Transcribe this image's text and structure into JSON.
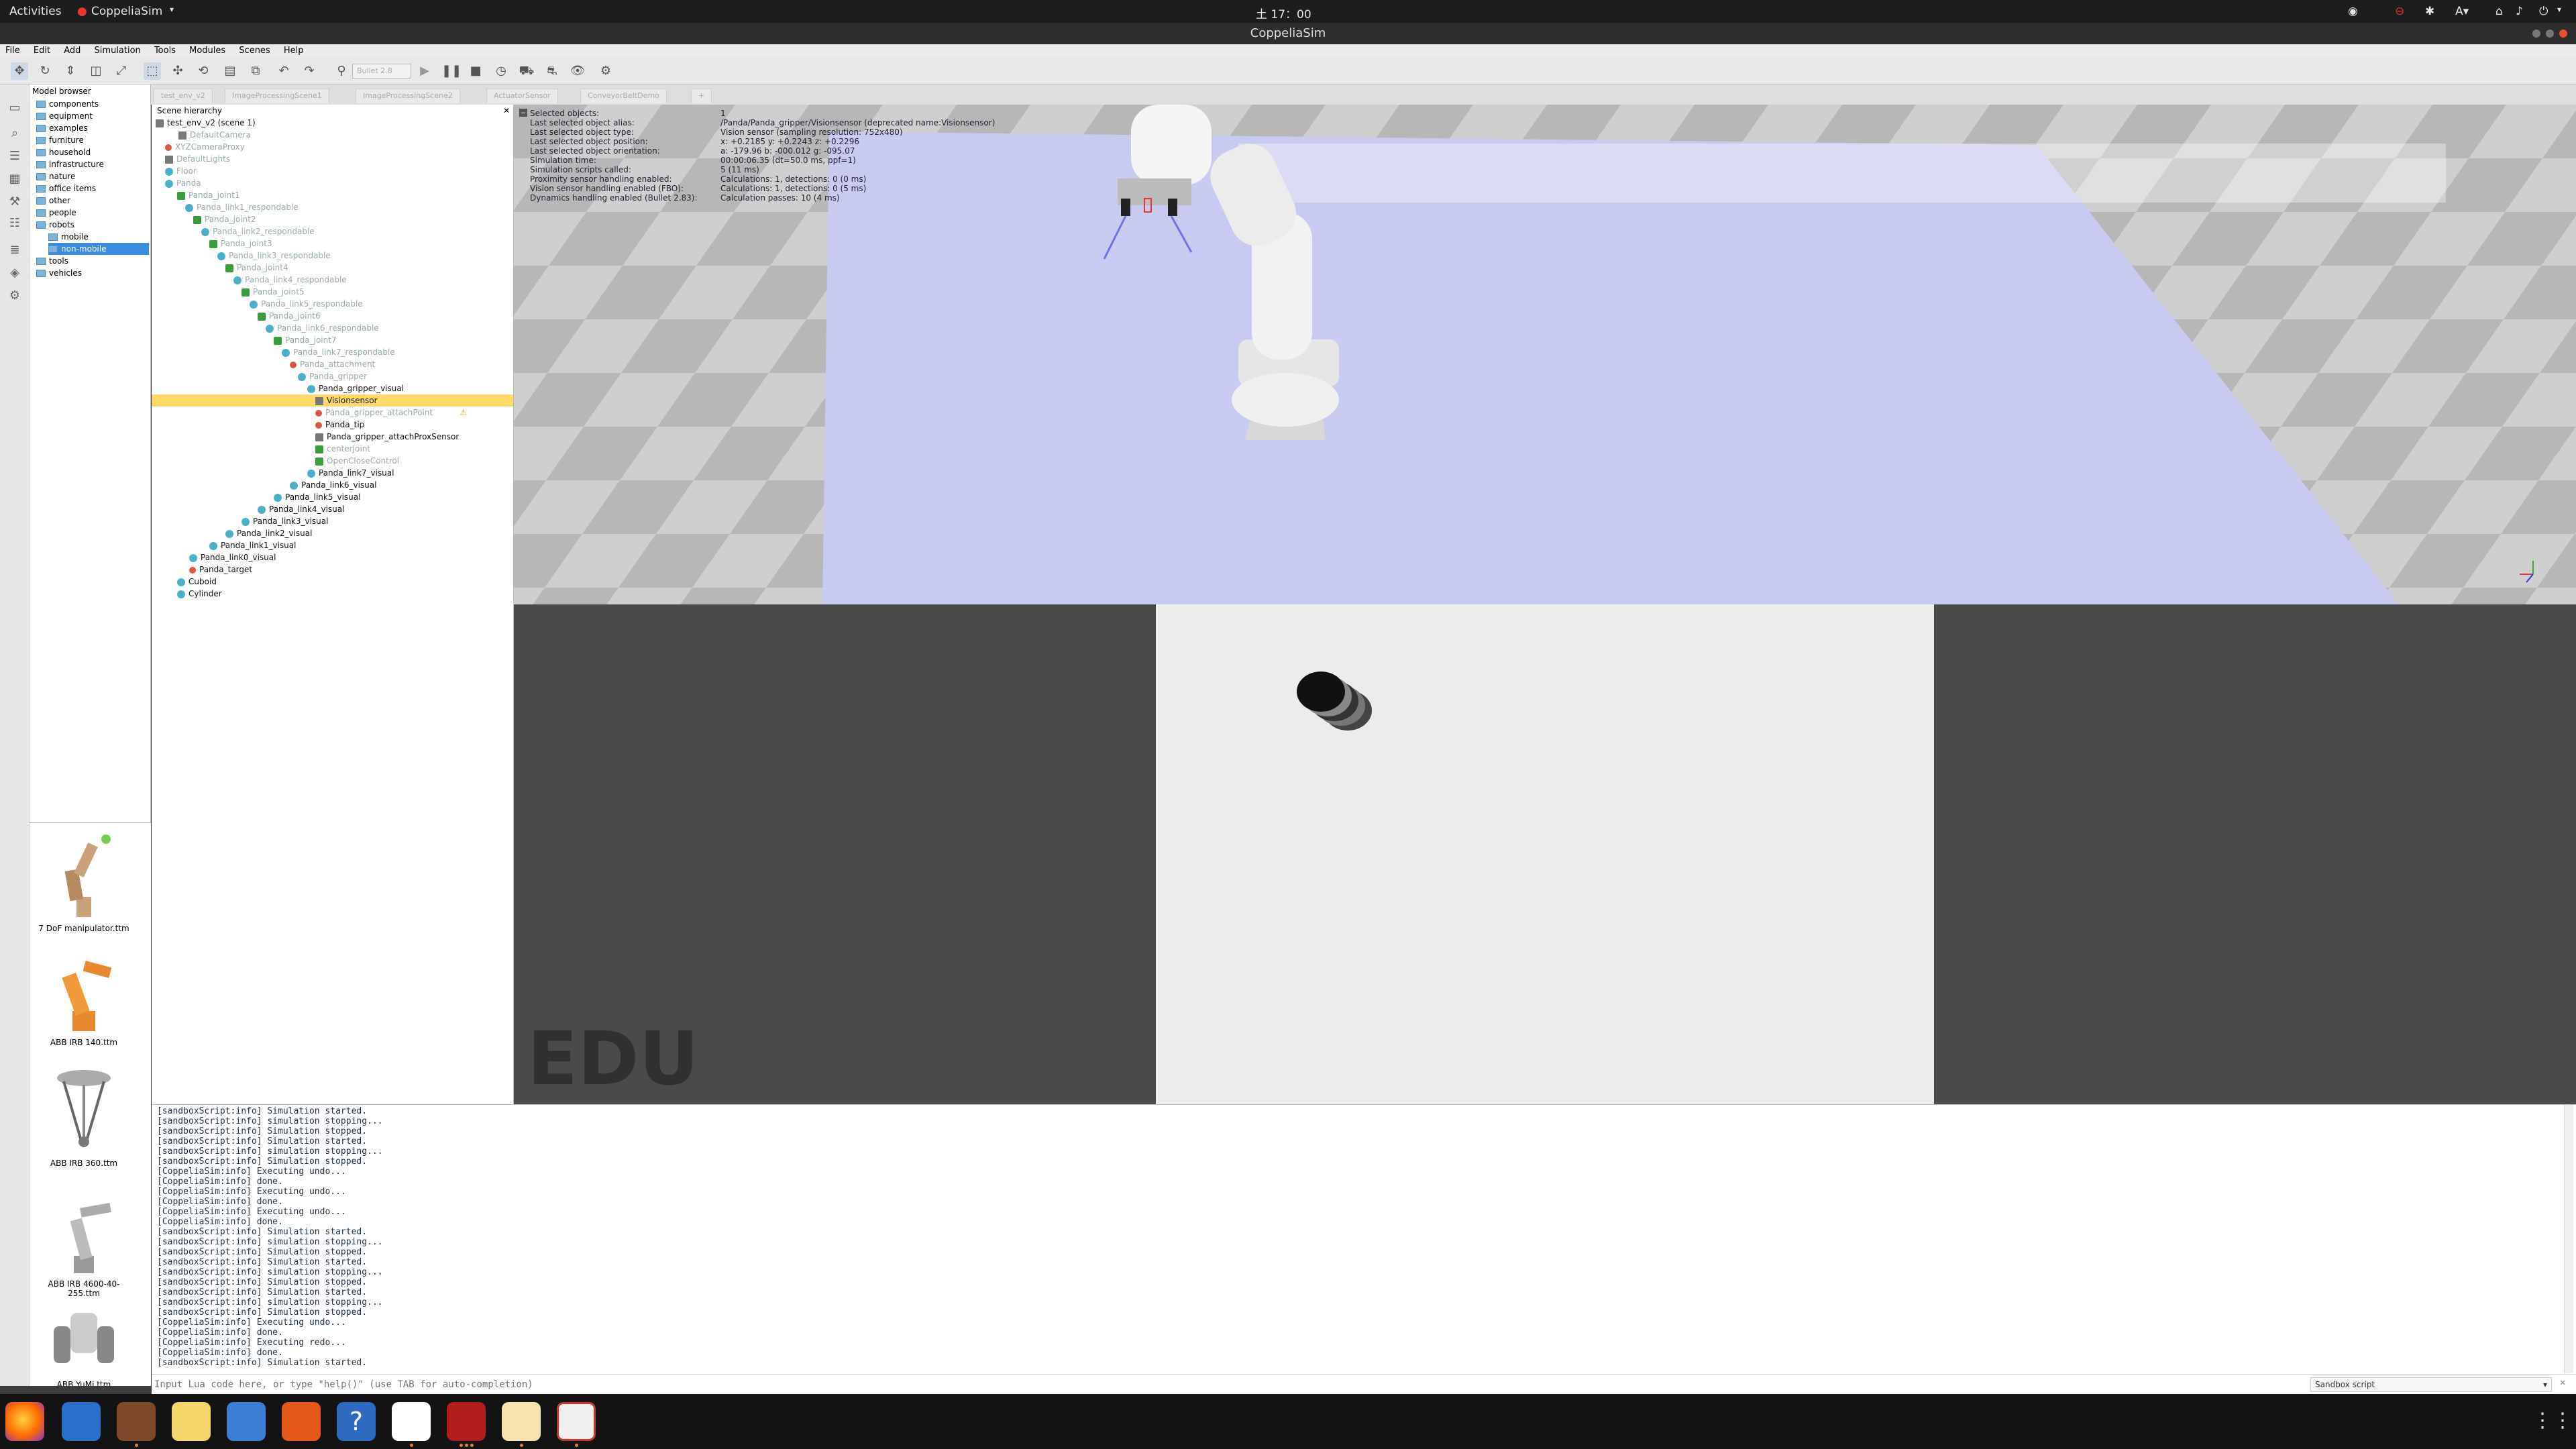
{
  "topbar": {
    "activities": "Activities",
    "app": "CoppeliaSim",
    "clock": "土 17：00"
  },
  "window": {
    "title": "CoppeliaSim"
  },
  "menu": [
    "File",
    "Edit",
    "Add",
    "Simulation",
    "Tools",
    "Modules",
    "Scenes",
    "Help"
  ],
  "toolbar": {
    "engine": "Bullet 2.8"
  },
  "tabs": [
    "test_env_v2",
    "ImageProcessingScene1",
    "ImageProcessingScene2",
    "ActuatorSensor",
    "ConveyorBeltDemo",
    "+"
  ],
  "model_browser": {
    "title": "Model browser",
    "items": [
      "components",
      "equipment",
      "examples",
      "furniture",
      "household",
      "infrastructure",
      "nature",
      "office items",
      "other",
      "people",
      "robots",
      "mobile",
      "non-mobile",
      "tools",
      "vehicles"
    ],
    "thumbs": [
      "7 DoF manipulator.ttm",
      "ABB IRB 140.ttm",
      "ABB IRB 360.ttm",
      "ABB IRB 4600-40-255.ttm",
      "ABB YuMi.ttm"
    ]
  },
  "scene_hierarchy": {
    "title": "Scene hierarchy",
    "rows": [
      "test_env_v2 (scene 1)",
      "DefaultCamera",
      "XYZCameraProxy",
      "DefaultLights",
      "Floor",
      "Panda",
      "Panda_joint1",
      "Panda_link1_respondable",
      "Panda_joint2",
      "Panda_link2_respondable",
      "Panda_joint3",
      "Panda_link3_respondable",
      "Panda_joint4",
      "Panda_link4_respondable",
      "Panda_joint5",
      "Panda_link5_respondable",
      "Panda_joint6",
      "Panda_link6_respondable",
      "Panda_joint7",
      "Panda_link7_respondable",
      "Panda_attachment",
      "Panda_gripper",
      "Panda_gripper_visual",
      "Visionsensor",
      "Panda_gripper_attachPoint",
      "Panda_tip",
      "Panda_gripper_attachProxSensor",
      "centerJoint",
      "OpenCloseControl",
      "Panda_link7_visual",
      "Panda_link6_visual",
      "Panda_link5_visual",
      "Panda_link4_visual",
      "Panda_link3_visual",
      "Panda_link2_visual",
      "Panda_link1_visual",
      "Panda_link0_visual",
      "Panda_target",
      "Cuboid",
      "Cylinder"
    ]
  },
  "info": {
    "labels": [
      "Selected objects:",
      "Last selected object alias:",
      "Last selected object type:",
      "Last selected object position:",
      "Last selected object orientation:",
      "Simulation time:",
      "Simulation scripts called:",
      "Proximity sensor handling enabled:",
      "Vision sensor handling enabled (FBO):",
      "Dynamics handling enabled (Bullet 2.83):"
    ],
    "values": [
      "1",
      "/Panda/Panda_gripper/Visionsensor (deprecated name:Visionsensor)",
      "Vision sensor (sampling resolution: 752x480)",
      "x: +0.2185   y: +0.2243   z: +0.2296",
      "a: -179.96   b: -000.012   g: -095.07",
      "00:00:06.35 (dt=50.0 ms, ppf=1)",
      "5 (11 ms)",
      "Calculations: 1, detections: 0 (0 ms)",
      "Calculations: 1, detections: 0 (5 ms)",
      "Calculation passes: 10 (4 ms)"
    ]
  },
  "watermark": "EDU",
  "console": [
    "[sandboxScript:info] Simulation started.",
    "[sandboxScript:info] simulation stopping...",
    "[sandboxScript:info] Simulation stopped.",
    "[sandboxScript:info] Simulation started.",
    "[sandboxScript:info] simulation stopping...",
    "[sandboxScript:info] Simulation stopped.",
    "[CoppeliaSim:info] Executing undo...",
    "[CoppeliaSim:info] done.",
    "[CoppeliaSim:info] Executing undo...",
    "[CoppeliaSim:info] done.",
    "[CoppeliaSim:info] Executing undo...",
    "[CoppeliaSim:info] done.",
    "[sandboxScript:info] Simulation started.",
    "[sandboxScript:info] simulation stopping...",
    "[sandboxScript:info] Simulation stopped.",
    "[sandboxScript:info] Simulation started.",
    "[sandboxScript:info] simulation stopping...",
    "[sandboxScript:info] Simulation stopped.",
    "[sandboxScript:info] Simulation started.",
    "[sandboxScript:info] simulation stopping...",
    "[sandboxScript:info] Simulation stopped.",
    "[CoppeliaSim:info] Executing undo...",
    "[CoppeliaSim:info] done.",
    "[CoppeliaSim:info] Executing redo...",
    "[CoppeliaSim:info] done.",
    "[sandboxScript:info] Simulation started."
  ],
  "lua": {
    "placeholder": "Input Lua code here, or type \"help()\" (use TAB for auto-completion)",
    "script": "Sandbox script"
  }
}
